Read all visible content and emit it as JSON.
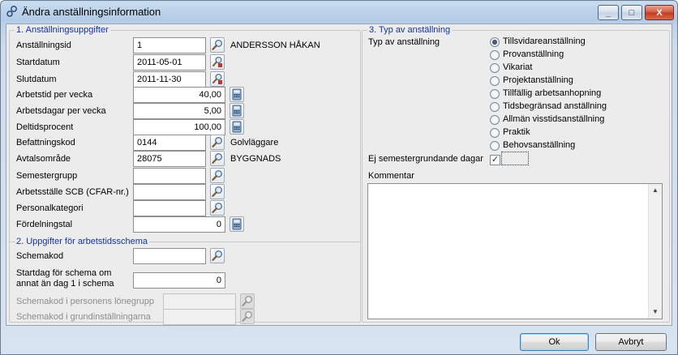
{
  "window": {
    "title": "Ändra anställningsinformation",
    "minimize": "_",
    "maximize": "□",
    "close": "X"
  },
  "section1": {
    "title": "1. Anställningsuppgifter",
    "rows": [
      {
        "label": "Anställningsid",
        "value": "1",
        "extra": "ANDERSSON HÅKAN"
      },
      {
        "label": "Startdatum",
        "value": "2011-05-01"
      },
      {
        "label": "Slutdatum",
        "value": "2011-11-30"
      },
      {
        "label": "Arbetstid per vecka",
        "value": "40,00"
      },
      {
        "label": "Arbetsdagar per vecka",
        "value": "5,00"
      },
      {
        "label": "Deltidsprocent",
        "value": "100,00"
      },
      {
        "label": "Befattningskod",
        "value": "0144",
        "extra": "Golvläggare"
      },
      {
        "label": "Avtalsområde",
        "value": "28075",
        "extra": "BYGGNADS"
      },
      {
        "label": "Semestergrupp",
        "value": ""
      },
      {
        "label": "Arbetsställe SCB (CFAR-nr.)",
        "value": ""
      },
      {
        "label": "Personalkategori",
        "value": ""
      },
      {
        "label": "Fördelningstal",
        "value": "0"
      }
    ]
  },
  "section2": {
    "title": "2. Uppgifter för arbetstidsschema",
    "schemakod_label": "Schemakod",
    "schemakod_value": "",
    "startdag_label_1": "Startdag för schema om",
    "startdag_label_2": "annat än dag 1 i schema",
    "startdag_value": "0",
    "lonegrupp_label": "Schemakod i personens lönegrupp",
    "lonegrupp_value": "",
    "grund_label": "Schemakod i grundinställningarna",
    "grund_value": ""
  },
  "section3": {
    "title": "3. Typ av anställning",
    "type_label": "Typ av anställning",
    "options": [
      "Tillsvidareanställning",
      "Provanställning",
      "Vikariat",
      "Projektanställning",
      "Tillfällig arbetsanhopning",
      "Tidsbegränsad anställning",
      "Allmän visstidsanställning",
      "Praktik",
      "Behovsanställning"
    ],
    "selected": "Tillsvidareanställning",
    "ej_sem_label": "Ej semestergrundande dagar",
    "ej_sem_checked": true,
    "kommentar_label": "Kommentar",
    "kommentar_value": ""
  },
  "buttons": {
    "ok": "Ok",
    "cancel": "Avbryt"
  },
  "colors": {
    "section_title": "#1432a6"
  }
}
